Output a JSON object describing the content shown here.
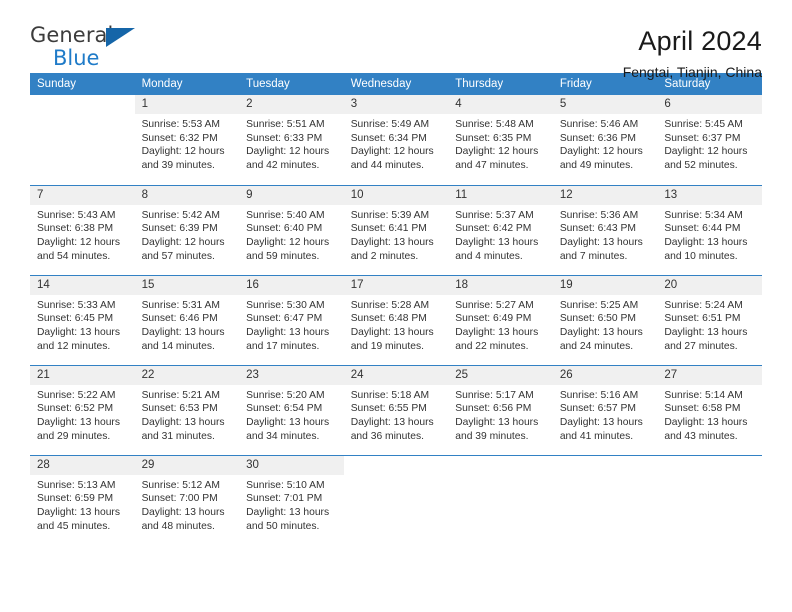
{
  "logo": {
    "word1": "General",
    "word2": "Blue",
    "triangle_color": "#1565a8",
    "blue_color": "#1f7bc8"
  },
  "header": {
    "title": "April 2024",
    "subtitle": "Fengtai, Tianjin, China"
  },
  "theme": {
    "header_bg": "#3281c4",
    "daynum_bg": "#f0f0f0",
    "separator": "#3281c4",
    "text": "#333333"
  },
  "weekdays": [
    "Sunday",
    "Monday",
    "Tuesday",
    "Wednesday",
    "Thursday",
    "Friday",
    "Saturday"
  ],
  "labels": {
    "sunrise": "Sunrise:",
    "sunset": "Sunset:",
    "daylight": "Daylight:"
  },
  "weeks": [
    [
      {
        "day": "",
        "l1": "",
        "l2": "",
        "l3": "",
        "l4": ""
      },
      {
        "day": "1",
        "l1": "Sunrise: 5:53 AM",
        "l2": "Sunset: 6:32 PM",
        "l3": "Daylight: 12 hours",
        "l4": "and 39 minutes."
      },
      {
        "day": "2",
        "l1": "Sunrise: 5:51 AM",
        "l2": "Sunset: 6:33 PM",
        "l3": "Daylight: 12 hours",
        "l4": "and 42 minutes."
      },
      {
        "day": "3",
        "l1": "Sunrise: 5:49 AM",
        "l2": "Sunset: 6:34 PM",
        "l3": "Daylight: 12 hours",
        "l4": "and 44 minutes."
      },
      {
        "day": "4",
        "l1": "Sunrise: 5:48 AM",
        "l2": "Sunset: 6:35 PM",
        "l3": "Daylight: 12 hours",
        "l4": "and 47 minutes."
      },
      {
        "day": "5",
        "l1": "Sunrise: 5:46 AM",
        "l2": "Sunset: 6:36 PM",
        "l3": "Daylight: 12 hours",
        "l4": "and 49 minutes."
      },
      {
        "day": "6",
        "l1": "Sunrise: 5:45 AM",
        "l2": "Sunset: 6:37 PM",
        "l3": "Daylight: 12 hours",
        "l4": "and 52 minutes."
      }
    ],
    [
      {
        "day": "7",
        "l1": "Sunrise: 5:43 AM",
        "l2": "Sunset: 6:38 PM",
        "l3": "Daylight: 12 hours",
        "l4": "and 54 minutes."
      },
      {
        "day": "8",
        "l1": "Sunrise: 5:42 AM",
        "l2": "Sunset: 6:39 PM",
        "l3": "Daylight: 12 hours",
        "l4": "and 57 minutes."
      },
      {
        "day": "9",
        "l1": "Sunrise: 5:40 AM",
        "l2": "Sunset: 6:40 PM",
        "l3": "Daylight: 12 hours",
        "l4": "and 59 minutes."
      },
      {
        "day": "10",
        "l1": "Sunrise: 5:39 AM",
        "l2": "Sunset: 6:41 PM",
        "l3": "Daylight: 13 hours",
        "l4": "and 2 minutes."
      },
      {
        "day": "11",
        "l1": "Sunrise: 5:37 AM",
        "l2": "Sunset: 6:42 PM",
        "l3": "Daylight: 13 hours",
        "l4": "and 4 minutes."
      },
      {
        "day": "12",
        "l1": "Sunrise: 5:36 AM",
        "l2": "Sunset: 6:43 PM",
        "l3": "Daylight: 13 hours",
        "l4": "and 7 minutes."
      },
      {
        "day": "13",
        "l1": "Sunrise: 5:34 AM",
        "l2": "Sunset: 6:44 PM",
        "l3": "Daylight: 13 hours",
        "l4": "and 10 minutes."
      }
    ],
    [
      {
        "day": "14",
        "l1": "Sunrise: 5:33 AM",
        "l2": "Sunset: 6:45 PM",
        "l3": "Daylight: 13 hours",
        "l4": "and 12 minutes."
      },
      {
        "day": "15",
        "l1": "Sunrise: 5:31 AM",
        "l2": "Sunset: 6:46 PM",
        "l3": "Daylight: 13 hours",
        "l4": "and 14 minutes."
      },
      {
        "day": "16",
        "l1": "Sunrise: 5:30 AM",
        "l2": "Sunset: 6:47 PM",
        "l3": "Daylight: 13 hours",
        "l4": "and 17 minutes."
      },
      {
        "day": "17",
        "l1": "Sunrise: 5:28 AM",
        "l2": "Sunset: 6:48 PM",
        "l3": "Daylight: 13 hours",
        "l4": "and 19 minutes."
      },
      {
        "day": "18",
        "l1": "Sunrise: 5:27 AM",
        "l2": "Sunset: 6:49 PM",
        "l3": "Daylight: 13 hours",
        "l4": "and 22 minutes."
      },
      {
        "day": "19",
        "l1": "Sunrise: 5:25 AM",
        "l2": "Sunset: 6:50 PM",
        "l3": "Daylight: 13 hours",
        "l4": "and 24 minutes."
      },
      {
        "day": "20",
        "l1": "Sunrise: 5:24 AM",
        "l2": "Sunset: 6:51 PM",
        "l3": "Daylight: 13 hours",
        "l4": "and 27 minutes."
      }
    ],
    [
      {
        "day": "21",
        "l1": "Sunrise: 5:22 AM",
        "l2": "Sunset: 6:52 PM",
        "l3": "Daylight: 13 hours",
        "l4": "and 29 minutes."
      },
      {
        "day": "22",
        "l1": "Sunrise: 5:21 AM",
        "l2": "Sunset: 6:53 PM",
        "l3": "Daylight: 13 hours",
        "l4": "and 31 minutes."
      },
      {
        "day": "23",
        "l1": "Sunrise: 5:20 AM",
        "l2": "Sunset: 6:54 PM",
        "l3": "Daylight: 13 hours",
        "l4": "and 34 minutes."
      },
      {
        "day": "24",
        "l1": "Sunrise: 5:18 AM",
        "l2": "Sunset: 6:55 PM",
        "l3": "Daylight: 13 hours",
        "l4": "and 36 minutes."
      },
      {
        "day": "25",
        "l1": "Sunrise: 5:17 AM",
        "l2": "Sunset: 6:56 PM",
        "l3": "Daylight: 13 hours",
        "l4": "and 39 minutes."
      },
      {
        "day": "26",
        "l1": "Sunrise: 5:16 AM",
        "l2": "Sunset: 6:57 PM",
        "l3": "Daylight: 13 hours",
        "l4": "and 41 minutes."
      },
      {
        "day": "27",
        "l1": "Sunrise: 5:14 AM",
        "l2": "Sunset: 6:58 PM",
        "l3": "Daylight: 13 hours",
        "l4": "and 43 minutes."
      }
    ],
    [
      {
        "day": "28",
        "l1": "Sunrise: 5:13 AM",
        "l2": "Sunset: 6:59 PM",
        "l3": "Daylight: 13 hours",
        "l4": "and 45 minutes."
      },
      {
        "day": "29",
        "l1": "Sunrise: 5:12 AM",
        "l2": "Sunset: 7:00 PM",
        "l3": "Daylight: 13 hours",
        "l4": "and 48 minutes."
      },
      {
        "day": "30",
        "l1": "Sunrise: 5:10 AM",
        "l2": "Sunset: 7:01 PM",
        "l3": "Daylight: 13 hours",
        "l4": "and 50 minutes."
      },
      {
        "day": "",
        "l1": "",
        "l2": "",
        "l3": "",
        "l4": ""
      },
      {
        "day": "",
        "l1": "",
        "l2": "",
        "l3": "",
        "l4": ""
      },
      {
        "day": "",
        "l1": "",
        "l2": "",
        "l3": "",
        "l4": ""
      },
      {
        "day": "",
        "l1": "",
        "l2": "",
        "l3": "",
        "l4": ""
      }
    ]
  ]
}
